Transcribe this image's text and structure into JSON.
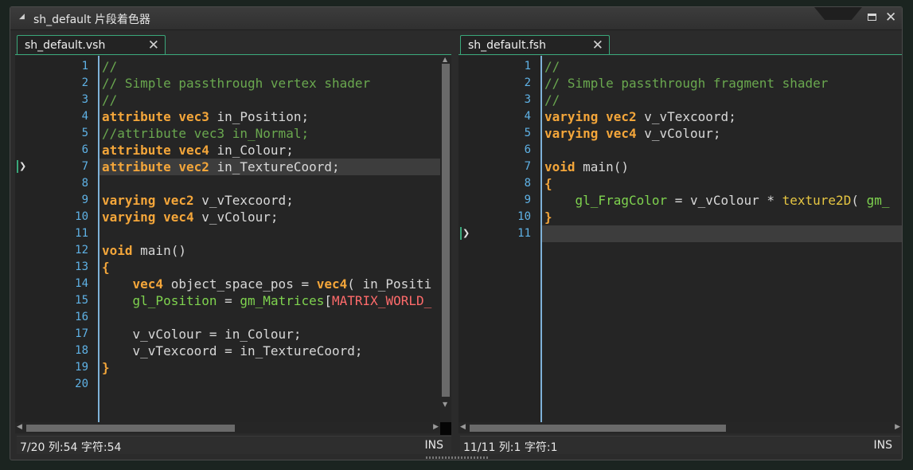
{
  "window": {
    "title": "sh_default 片段着色器",
    "maximize_label": "",
    "close_glyph": "✕"
  },
  "left": {
    "tab_label": "sh_default.vsh",
    "tab_close_glyph": "✕",
    "status_position": "7/20 列:54 字符:54",
    "status_mode": "INS",
    "current_line": 7,
    "lines": [
      {
        "n": "1",
        "t": [
          [
            "c",
            "//"
          ]
        ]
      },
      {
        "n": "2",
        "t": [
          [
            "c",
            "// Simple passthrough vertex shader"
          ]
        ]
      },
      {
        "n": "3",
        "t": [
          [
            "c",
            "//"
          ]
        ]
      },
      {
        "n": "4",
        "t": [
          [
            "k",
            "attribute vec3"
          ],
          [
            "p",
            " in_Position;"
          ]
        ]
      },
      {
        "n": "5",
        "t": [
          [
            "c",
            "//attribute vec3 in_Normal;"
          ]
        ]
      },
      {
        "n": "6",
        "t": [
          [
            "k",
            "attribute vec4"
          ],
          [
            "p",
            " in_Colour;"
          ]
        ]
      },
      {
        "n": "7",
        "t": [
          [
            "k",
            "attribute vec2"
          ],
          [
            "p",
            " in_TextureCoord;"
          ]
        ]
      },
      {
        "n": "8",
        "t": []
      },
      {
        "n": "9",
        "t": [
          [
            "k",
            "varying vec2"
          ],
          [
            "p",
            " v_vTexcoord;"
          ]
        ]
      },
      {
        "n": "10",
        "t": [
          [
            "k",
            "varying vec4"
          ],
          [
            "p",
            " v_vColour;"
          ]
        ]
      },
      {
        "n": "11",
        "t": []
      },
      {
        "n": "12",
        "t": [
          [
            "k",
            "void"
          ],
          [
            "p",
            " main()"
          ]
        ]
      },
      {
        "n": "13",
        "t": [
          [
            "k",
            "{"
          ]
        ]
      },
      {
        "n": "14",
        "t": [
          [
            "p",
            "    "
          ],
          [
            "k",
            "vec4"
          ],
          [
            "p",
            " object_space_pos = "
          ],
          [
            "k",
            "vec4"
          ],
          [
            "p",
            "( in_Positi"
          ]
        ]
      },
      {
        "n": "15",
        "t": [
          [
            "p",
            "    "
          ],
          [
            "f",
            "gl_Position"
          ],
          [
            "p",
            " = "
          ],
          [
            "f",
            "gm_Matrices"
          ],
          [
            "p",
            "["
          ],
          [
            "r",
            "MATRIX_WORLD_"
          ]
        ]
      },
      {
        "n": "16",
        "t": []
      },
      {
        "n": "17",
        "t": [
          [
            "p",
            "    v_vColour = in_Colour;"
          ]
        ]
      },
      {
        "n": "18",
        "t": [
          [
            "p",
            "    v_vTexcoord = in_TextureCoord;"
          ]
        ]
      },
      {
        "n": "19",
        "t": [
          [
            "k",
            "}"
          ]
        ]
      },
      {
        "n": "20",
        "t": []
      }
    ]
  },
  "right": {
    "tab_label": "sh_default.fsh",
    "tab_close_glyph": "✕",
    "status_position": "11/11 列:1 字符:1",
    "status_mode": "INS",
    "current_line": 11,
    "lines": [
      {
        "n": "1",
        "t": [
          [
            "c",
            "//"
          ]
        ]
      },
      {
        "n": "2",
        "t": [
          [
            "c",
            "// Simple passthrough fragment shader"
          ]
        ]
      },
      {
        "n": "3",
        "t": [
          [
            "c",
            "//"
          ]
        ]
      },
      {
        "n": "4",
        "t": [
          [
            "k",
            "varying vec2"
          ],
          [
            "p",
            " v_vTexcoord;"
          ]
        ]
      },
      {
        "n": "5",
        "t": [
          [
            "k",
            "varying vec4"
          ],
          [
            "p",
            " v_vColour;"
          ]
        ]
      },
      {
        "n": "6",
        "t": []
      },
      {
        "n": "7",
        "t": [
          [
            "k",
            "void"
          ],
          [
            "p",
            " main()"
          ]
        ]
      },
      {
        "n": "8",
        "t": [
          [
            "k",
            "{"
          ]
        ]
      },
      {
        "n": "9",
        "t": [
          [
            "p",
            "    "
          ],
          [
            "f",
            "gl_FragColor"
          ],
          [
            "p",
            " = v_vColour * "
          ],
          [
            "y",
            "texture2D"
          ],
          [
            "p",
            "( "
          ],
          [
            "f",
            "gm_"
          ]
        ]
      },
      {
        "n": "10",
        "t": [
          [
            "k",
            "}"
          ]
        ]
      },
      {
        "n": "11",
        "t": []
      }
    ]
  },
  "colors": {
    "comment": "#6aa84f",
    "keyword": "#f4a63a",
    "builtin": "#7fd34f",
    "function": "#e6c642",
    "constant": "#ff6b6b",
    "line_number": "#5fb2e6",
    "tab_accent": "#3aa77a"
  }
}
